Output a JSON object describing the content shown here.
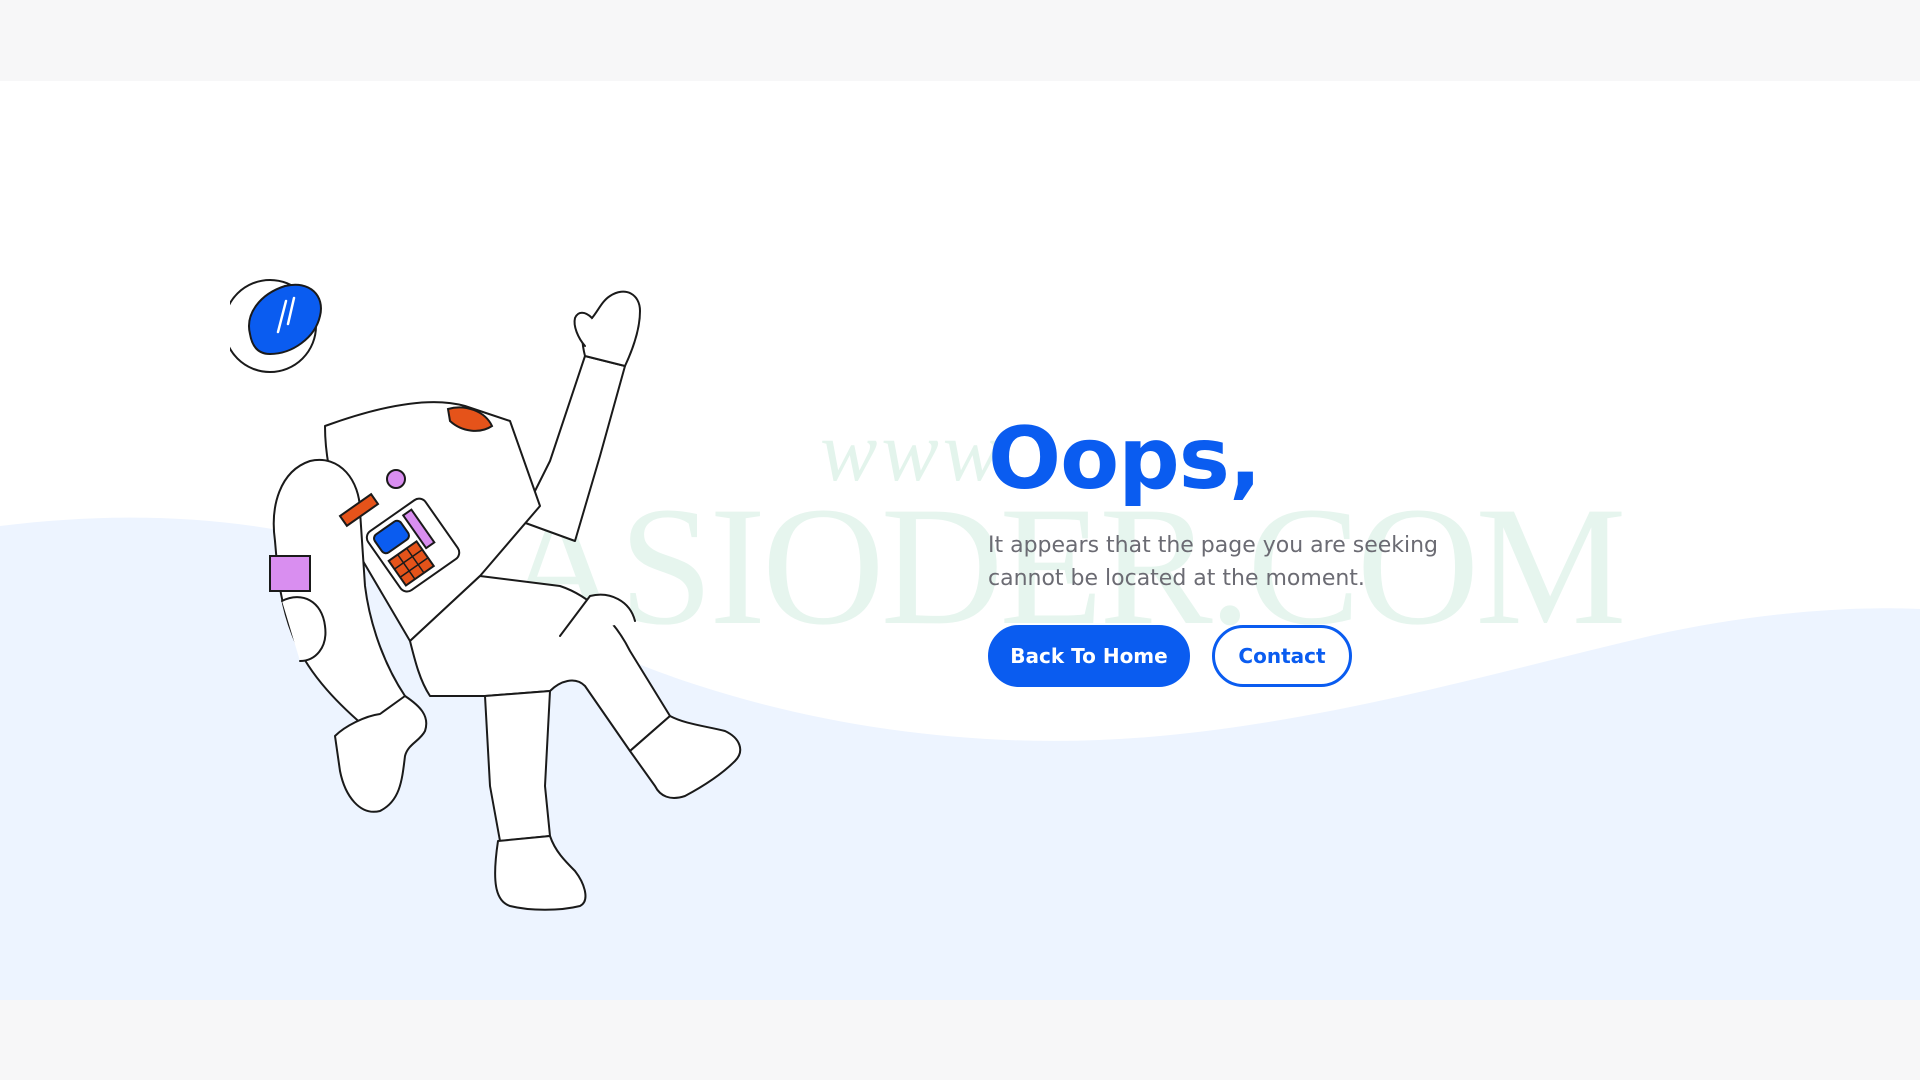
{
  "page": {
    "title": "Oops,",
    "message": "It appears that the page you are seeking cannot be located at the moment."
  },
  "actions": {
    "home_label": "Back To Home",
    "contact_label": "Contact"
  },
  "watermark": {
    "line1": "www.",
    "line2": "ASIODER.COM"
  },
  "illustration": {
    "subject": "astronaut-illustration",
    "icon_name": "astronaut-icon"
  },
  "colors": {
    "accent": "#0a5cf0",
    "wave": "#edf4ff",
    "text_muted": "#6b6b73",
    "suit_patch_orange": "#e5531a",
    "suit_patch_purple": "#d98ef0"
  }
}
